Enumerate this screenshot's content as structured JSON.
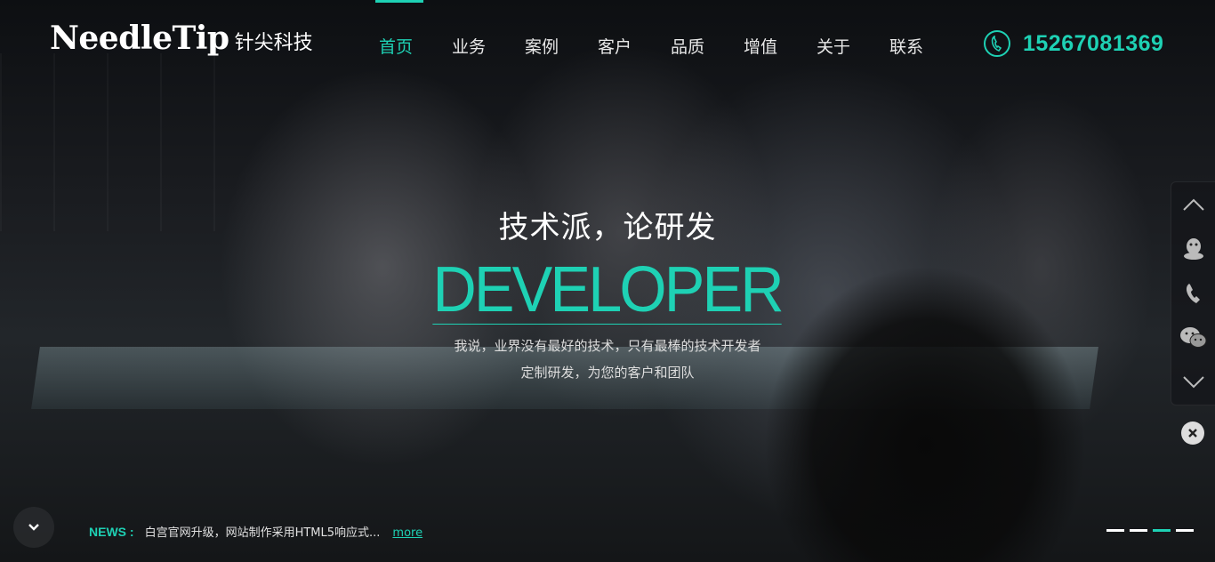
{
  "header": {
    "logo_en": "NeedleTip",
    "logo_cn": "针尖科技",
    "nav": [
      {
        "label": "首页",
        "active": true
      },
      {
        "label": "业务"
      },
      {
        "label": "案例"
      },
      {
        "label": "客户"
      },
      {
        "label": "品质"
      },
      {
        "label": "增值"
      },
      {
        "label": "关于"
      },
      {
        "label": "联系"
      }
    ],
    "phone": "15267081369"
  },
  "hero": {
    "title_cn": "技术派，论研发",
    "title_en": "DEVELOPER",
    "subtitle_line1": "我说，业界没有最好的技术，只有最棒的技术开发者",
    "subtitle_line2": "定制研发，为您的客户和团队"
  },
  "news": {
    "label": "NEWS :",
    "text": "白宫官网升级，网站制作采用HTML5响应式...",
    "more": "more"
  },
  "sidebar": {
    "icons": [
      "chevron-up-icon",
      "qq-icon",
      "phone-icon",
      "wechat-icon",
      "chevron-down-icon"
    ]
  },
  "slider": {
    "count": 4,
    "active_index": 2
  },
  "colors": {
    "accent": "#1ed1b4"
  }
}
